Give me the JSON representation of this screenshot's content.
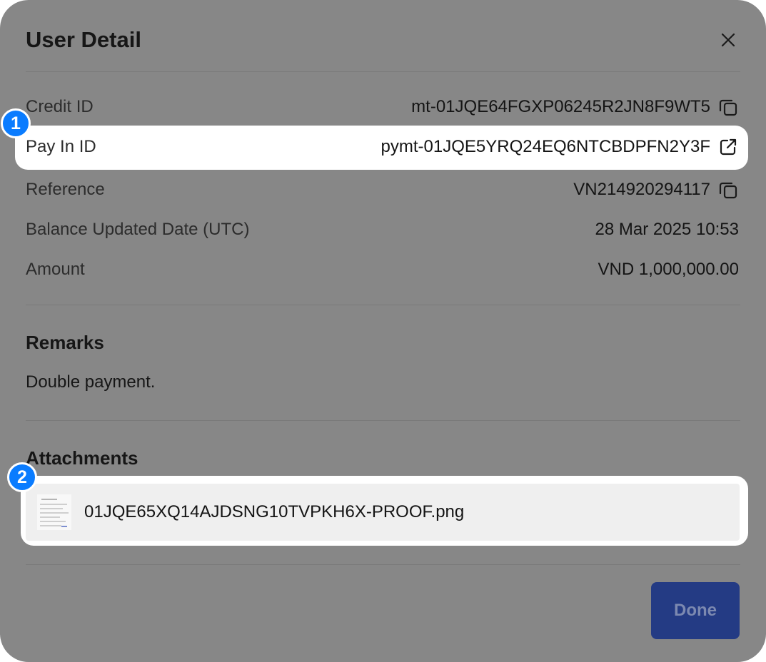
{
  "dialog": {
    "title": "User Detail"
  },
  "details": {
    "credit_id": {
      "label": "Credit ID",
      "value": "mt-01JQE64FGXP06245R2JN8F9WT5"
    },
    "pay_in_id": {
      "label": "Pay In ID",
      "value": "pymt-01JQE5YRQ24EQ6NTCBDPFN2Y3F"
    },
    "reference": {
      "label": "Reference",
      "value": "VN214920294117"
    },
    "balance_updated_date": {
      "label": "Balance Updated Date (UTC)",
      "value": "28 Mar 2025 10:53"
    },
    "amount": {
      "label": "Amount",
      "value": "VND 1,000,000.00"
    }
  },
  "remarks": {
    "title": "Remarks",
    "text": "Double payment."
  },
  "attachments": {
    "title": "Attachments",
    "items": [
      {
        "file_name": "01JQE65XQ14AJDSNG10TVPKH6X-PROOF.png"
      }
    ]
  },
  "annotations": {
    "badge_1": "1",
    "badge_2": "2"
  },
  "footer": {
    "done_label": "Done"
  },
  "icons": {
    "close": "close-icon",
    "copy": "copy-icon",
    "external_link": "external-link-icon",
    "attachment_thumbnail": "image-thumbnail-icon"
  },
  "colors": {
    "overlay_background": "#878787",
    "badge_accent": "#0a7cff",
    "done_button": "#243b84"
  }
}
